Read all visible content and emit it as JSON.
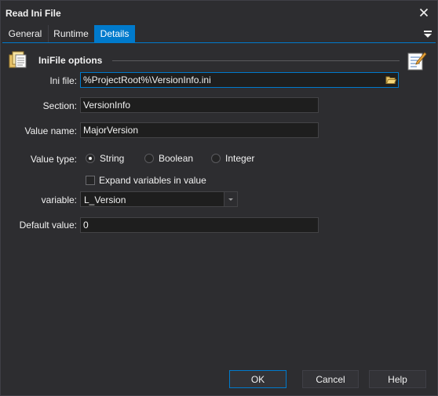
{
  "window": {
    "title": "Read Ini File",
    "close_icon": "close-icon"
  },
  "tabs": [
    {
      "label": "General",
      "active": false
    },
    {
      "label": "Runtime",
      "active": false
    },
    {
      "label": "Details",
      "active": true
    }
  ],
  "group": {
    "title": "IniFile options",
    "icon": "ini-file-icon",
    "notes_icon": "notes-icon"
  },
  "form": {
    "ini_file": {
      "label": "Ini file:",
      "value": "%ProjectRoot%\\VersionInfo.ini"
    },
    "section": {
      "label": "Section:",
      "value": "VersionInfo"
    },
    "value_name": {
      "label": "Value name:",
      "value": "MajorVersion"
    },
    "value_type": {
      "label": "Value type:",
      "options": [
        "String",
        "Boolean",
        "Integer"
      ],
      "selected": "String"
    },
    "expand_variables": {
      "label": "Expand variables in value",
      "checked": false
    },
    "variable": {
      "label": "variable:",
      "value": "L_Version"
    },
    "default_value": {
      "label": "Default value:",
      "value": "0"
    }
  },
  "buttons": {
    "ok": "OK",
    "cancel": "Cancel",
    "help": "Help"
  },
  "colors": {
    "accent": "#007acc",
    "background": "#2d2d30",
    "input_bg": "#1e1e1e"
  }
}
